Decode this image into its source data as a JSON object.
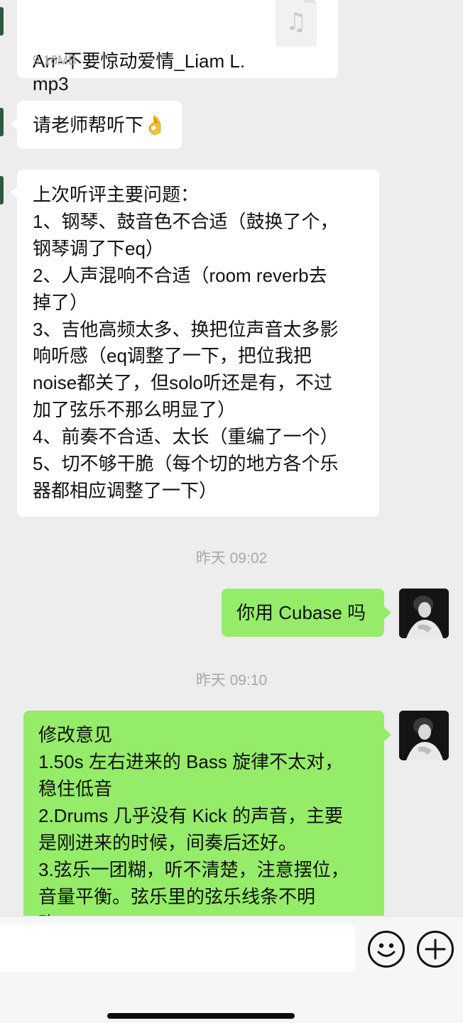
{
  "messages": {
    "file": {
      "name": "Arr-不要惊动爱情_Liam L.mp3",
      "size": "9.16MB",
      "icon": "music-note-icon"
    },
    "request": "请老师帮听下👌",
    "review": "上次听评主要问题：\n1、钢琴、鼓音色不合适（鼓换了个，\n钢琴调了下eq）\n2、人声混响不合适（room reverb去\n掉了）\n3、吉他高频太多、换把位声音太多影\n响听感（eq调整了一下，把位我把\nnoise都关了，但solo听还是有，不过\n加了弦乐不那么明显了）\n4、前奏不合适、太长（重编了一个）\n5、切不够干脆（每个切的地方各个乐\n器都相应调整了一下）",
    "time1": "昨天 09:02",
    "reply1": "你用 Cubase 吗",
    "time2": "昨天 09:10",
    "reply2": "修改意见\n1.50s 左右进来的 Bass 旋律不太对，\n稳住低音\n2.Drums 几乎没有 Kick 的声音，主要\n是刚进来的时候，间奏后还好。\n3.弦乐一团糊，听不清楚，注意摆位，\n音量平衡。弦乐里的弦乐线条不明\n确"
  },
  "input_bar": {
    "emoji_icon": "emoji-icon",
    "plus_icon": "plus-icon"
  },
  "colors": {
    "background": "#ededed",
    "incoming_bubble": "#ffffff",
    "outgoing_bubble": "#95ec69"
  }
}
